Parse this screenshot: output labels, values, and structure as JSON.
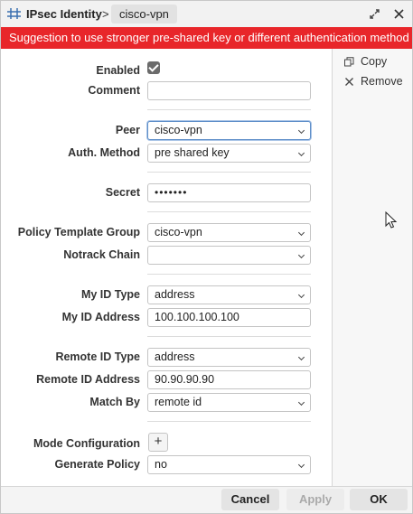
{
  "titlebar": {
    "title": "IPsec Identity",
    "separator": ">",
    "item": "cisco-vpn",
    "icons": [
      "ipsec-app-icon",
      "restore-icon",
      "close-icon"
    ]
  },
  "banner": {
    "text": "Suggestion to use stronger pre-shared key or different authentication method",
    "color": "#e8262a"
  },
  "form": {
    "enabled": {
      "label": "Enabled",
      "checked": true
    },
    "comment": {
      "label": "Comment",
      "value": ""
    },
    "peer": {
      "label": "Peer",
      "value": "cisco-vpn"
    },
    "auth_method": {
      "label": "Auth. Method",
      "value": "pre shared key"
    },
    "secret": {
      "label": "Secret",
      "value": "•••••••"
    },
    "policy_template_group": {
      "label": "Policy Template Group",
      "value": "cisco-vpn"
    },
    "notrack_chain": {
      "label": "Notrack Chain",
      "value": ""
    },
    "my_id_type": {
      "label": "My ID Type",
      "value": "address"
    },
    "my_id_address": {
      "label": "My ID Address",
      "value": "100.100.100.100"
    },
    "remote_id_type": {
      "label": "Remote ID Type",
      "value": "address"
    },
    "remote_id_address": {
      "label": "Remote ID Address",
      "value": "90.90.90.90"
    },
    "match_by": {
      "label": "Match By",
      "value": "remote id"
    },
    "mode_configuration": {
      "label": "Mode Configuration",
      "button": "+"
    },
    "generate_policy": {
      "label": "Generate Policy",
      "value": "no"
    }
  },
  "side": {
    "copy_label": "Copy",
    "remove_label": "Remove"
  },
  "footer": {
    "cancel_label": "Cancel",
    "apply_label": "Apply",
    "ok_label": "OK"
  }
}
